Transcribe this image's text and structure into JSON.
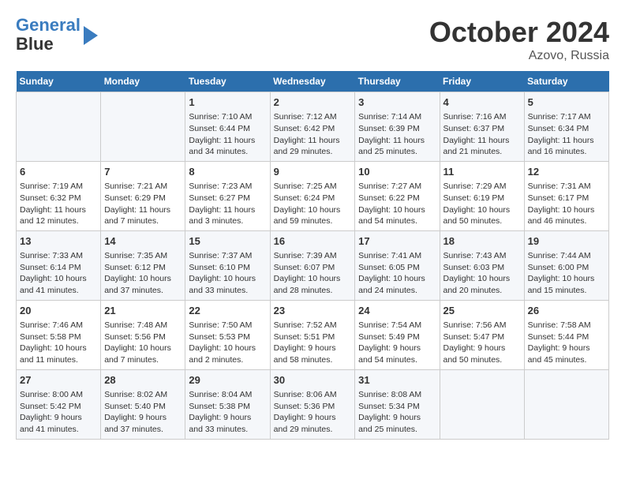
{
  "logo": {
    "line1": "General",
    "line2": "Blue"
  },
  "title": "October 2024",
  "subtitle": "Azovo, Russia",
  "days_of_week": [
    "Sunday",
    "Monday",
    "Tuesday",
    "Wednesday",
    "Thursday",
    "Friday",
    "Saturday"
  ],
  "weeks": [
    [
      {
        "day": "",
        "data": ""
      },
      {
        "day": "",
        "data": ""
      },
      {
        "day": "1",
        "data": "Sunrise: 7:10 AM\nSunset: 6:44 PM\nDaylight: 11 hours and 34 minutes."
      },
      {
        "day": "2",
        "data": "Sunrise: 7:12 AM\nSunset: 6:42 PM\nDaylight: 11 hours and 29 minutes."
      },
      {
        "day": "3",
        "data": "Sunrise: 7:14 AM\nSunset: 6:39 PM\nDaylight: 11 hours and 25 minutes."
      },
      {
        "day": "4",
        "data": "Sunrise: 7:16 AM\nSunset: 6:37 PM\nDaylight: 11 hours and 21 minutes."
      },
      {
        "day": "5",
        "data": "Sunrise: 7:17 AM\nSunset: 6:34 PM\nDaylight: 11 hours and 16 minutes."
      }
    ],
    [
      {
        "day": "6",
        "data": "Sunrise: 7:19 AM\nSunset: 6:32 PM\nDaylight: 11 hours and 12 minutes."
      },
      {
        "day": "7",
        "data": "Sunrise: 7:21 AM\nSunset: 6:29 PM\nDaylight: 11 hours and 7 minutes."
      },
      {
        "day": "8",
        "data": "Sunrise: 7:23 AM\nSunset: 6:27 PM\nDaylight: 11 hours and 3 minutes."
      },
      {
        "day": "9",
        "data": "Sunrise: 7:25 AM\nSunset: 6:24 PM\nDaylight: 10 hours and 59 minutes."
      },
      {
        "day": "10",
        "data": "Sunrise: 7:27 AM\nSunset: 6:22 PM\nDaylight: 10 hours and 54 minutes."
      },
      {
        "day": "11",
        "data": "Sunrise: 7:29 AM\nSunset: 6:19 PM\nDaylight: 10 hours and 50 minutes."
      },
      {
        "day": "12",
        "data": "Sunrise: 7:31 AM\nSunset: 6:17 PM\nDaylight: 10 hours and 46 minutes."
      }
    ],
    [
      {
        "day": "13",
        "data": "Sunrise: 7:33 AM\nSunset: 6:14 PM\nDaylight: 10 hours and 41 minutes."
      },
      {
        "day": "14",
        "data": "Sunrise: 7:35 AM\nSunset: 6:12 PM\nDaylight: 10 hours and 37 minutes."
      },
      {
        "day": "15",
        "data": "Sunrise: 7:37 AM\nSunset: 6:10 PM\nDaylight: 10 hours and 33 minutes."
      },
      {
        "day": "16",
        "data": "Sunrise: 7:39 AM\nSunset: 6:07 PM\nDaylight: 10 hours and 28 minutes."
      },
      {
        "day": "17",
        "data": "Sunrise: 7:41 AM\nSunset: 6:05 PM\nDaylight: 10 hours and 24 minutes."
      },
      {
        "day": "18",
        "data": "Sunrise: 7:43 AM\nSunset: 6:03 PM\nDaylight: 10 hours and 20 minutes."
      },
      {
        "day": "19",
        "data": "Sunrise: 7:44 AM\nSunset: 6:00 PM\nDaylight: 10 hours and 15 minutes."
      }
    ],
    [
      {
        "day": "20",
        "data": "Sunrise: 7:46 AM\nSunset: 5:58 PM\nDaylight: 10 hours and 11 minutes."
      },
      {
        "day": "21",
        "data": "Sunrise: 7:48 AM\nSunset: 5:56 PM\nDaylight: 10 hours and 7 minutes."
      },
      {
        "day": "22",
        "data": "Sunrise: 7:50 AM\nSunset: 5:53 PM\nDaylight: 10 hours and 2 minutes."
      },
      {
        "day": "23",
        "data": "Sunrise: 7:52 AM\nSunset: 5:51 PM\nDaylight: 9 hours and 58 minutes."
      },
      {
        "day": "24",
        "data": "Sunrise: 7:54 AM\nSunset: 5:49 PM\nDaylight: 9 hours and 54 minutes."
      },
      {
        "day": "25",
        "data": "Sunrise: 7:56 AM\nSunset: 5:47 PM\nDaylight: 9 hours and 50 minutes."
      },
      {
        "day": "26",
        "data": "Sunrise: 7:58 AM\nSunset: 5:44 PM\nDaylight: 9 hours and 45 minutes."
      }
    ],
    [
      {
        "day": "27",
        "data": "Sunrise: 8:00 AM\nSunset: 5:42 PM\nDaylight: 9 hours and 41 minutes."
      },
      {
        "day": "28",
        "data": "Sunrise: 8:02 AM\nSunset: 5:40 PM\nDaylight: 9 hours and 37 minutes."
      },
      {
        "day": "29",
        "data": "Sunrise: 8:04 AM\nSunset: 5:38 PM\nDaylight: 9 hours and 33 minutes."
      },
      {
        "day": "30",
        "data": "Sunrise: 8:06 AM\nSunset: 5:36 PM\nDaylight: 9 hours and 29 minutes."
      },
      {
        "day": "31",
        "data": "Sunrise: 8:08 AM\nSunset: 5:34 PM\nDaylight: 9 hours and 25 minutes."
      },
      {
        "day": "",
        "data": ""
      },
      {
        "day": "",
        "data": ""
      }
    ]
  ]
}
